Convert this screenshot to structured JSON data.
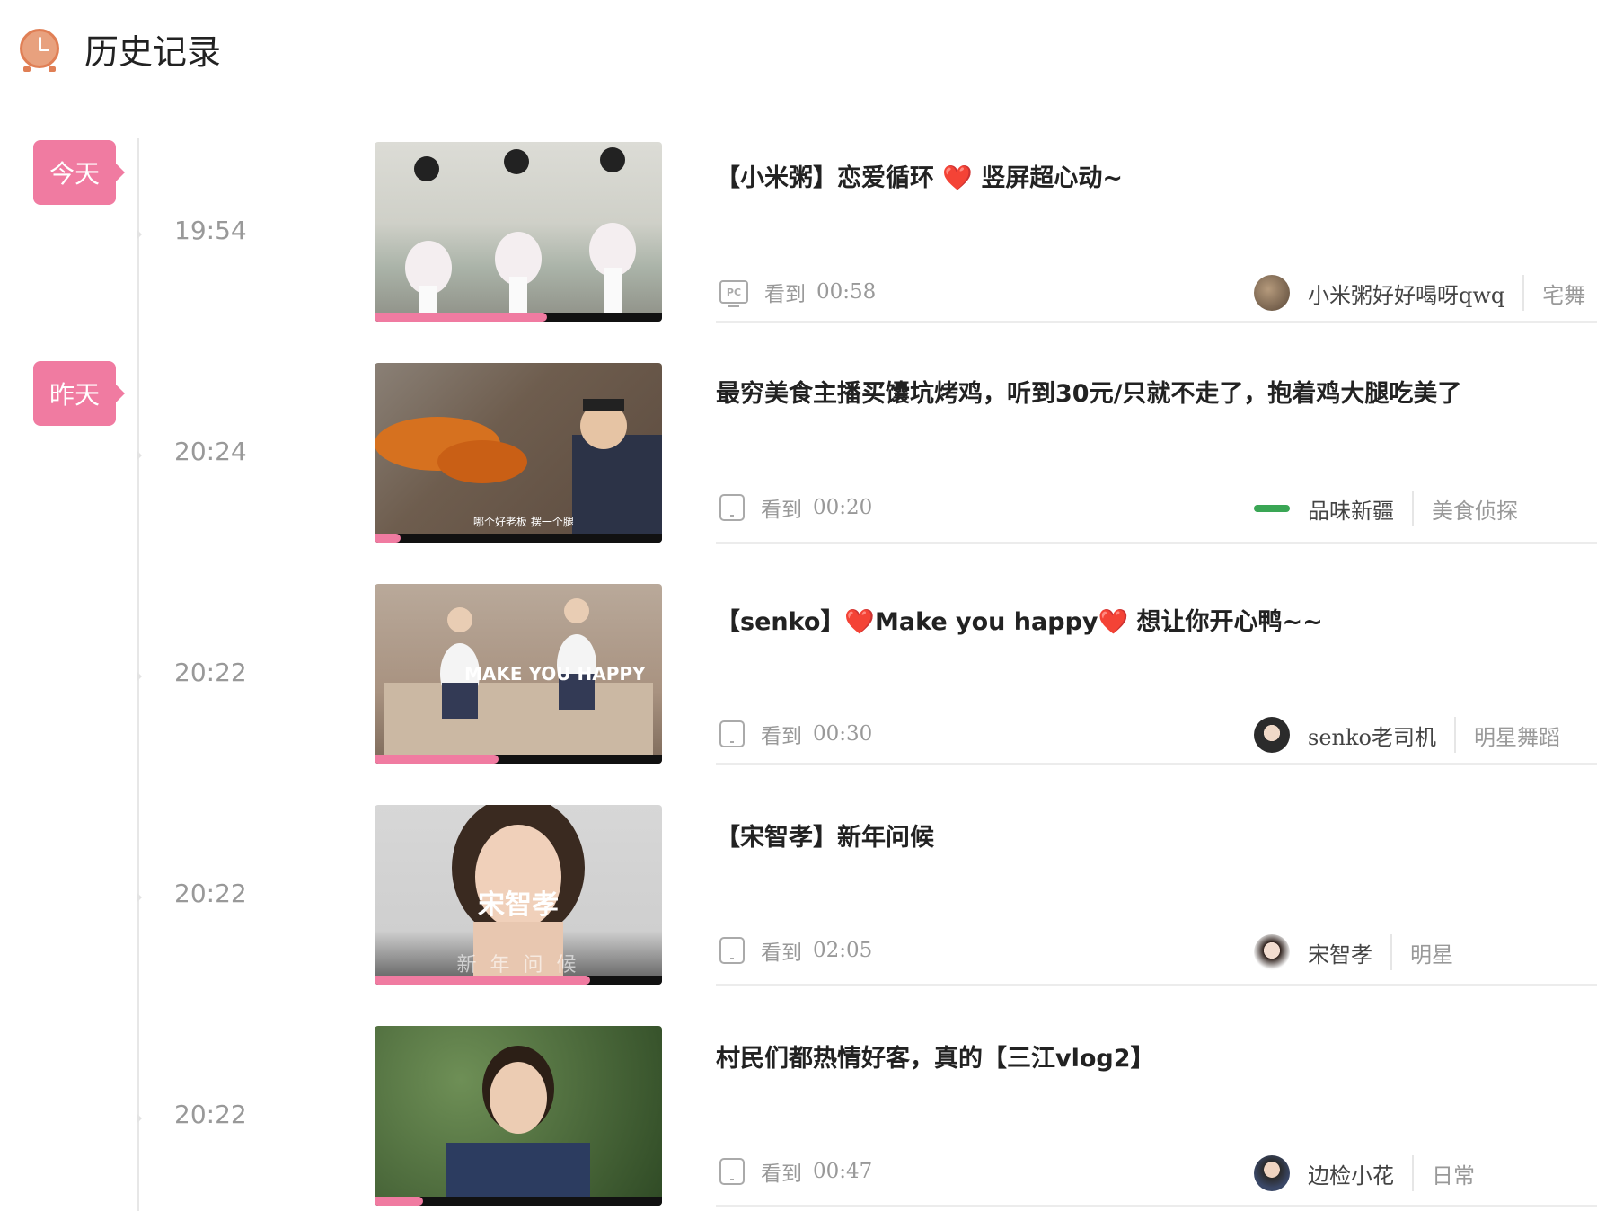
{
  "header": {
    "title": "历史记录"
  },
  "days": [
    "今天",
    "昨天"
  ],
  "watched_label": "看到",
  "items": [
    {
      "time": "19:54",
      "title": "【小米粥】恋爱循环 ❤️ 竖屏超心动~",
      "device": "PC",
      "watched": "00:58",
      "author": "小米粥好好喝呀qwq",
      "category": "宅舞",
      "progress": 0.6
    },
    {
      "time": "20:24",
      "title": "最穷美食主播买馕坑烤鸡，听到30元/只就不走了，抱着鸡大腿吃美了",
      "device": "",
      "watched": "00:20",
      "author": "品味新疆",
      "category": "美食侦探",
      "progress": 0.09,
      "caption": "哪个好老板 摆一个腿"
    },
    {
      "time": "20:22",
      "title": "【senko】❤️Make you happy❤️ 想让你开心鸭~~",
      "device": "",
      "watched": "00:30",
      "author": "senko老司机",
      "category": "明星舞蹈",
      "progress": 0.43,
      "caption": "MAKE YOU HAPPY"
    },
    {
      "time": "20:22",
      "title": "【宋智孝】新年问候",
      "device": "",
      "watched": "02:05",
      "author": "宋智孝",
      "category": "明星",
      "progress": 0.75,
      "caption": "宋智孝",
      "subcaption": "新 年 问 候"
    },
    {
      "time": "20:22",
      "title": "村民们都热情好客，真的【三江vlog2】",
      "device": "",
      "watched": "00:47",
      "author": "边检小花",
      "category": "日常",
      "progress": 0.17
    }
  ]
}
